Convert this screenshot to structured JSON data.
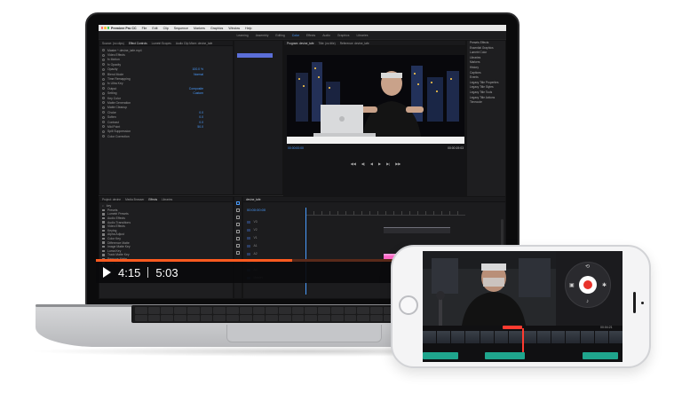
{
  "mac_menu": {
    "app": "Premiere Pro CC",
    "items": [
      "File",
      "Edit",
      "Clip",
      "Sequence",
      "Markers",
      "Graphics",
      "Window",
      "Help"
    ]
  },
  "workspaces": {
    "items": [
      "Learning",
      "Assembly",
      "Editing",
      "Color",
      "Effects",
      "Audio",
      "Graphics",
      "Libraries"
    ],
    "active_index": 3
  },
  "effect_controls": {
    "tabs": [
      "Source: (no clips)",
      "Effect Controls",
      "Lumetri Scopes",
      "Audio Clip Mixer: devine_tafe"
    ],
    "active_tab": 1,
    "rows": [
      {
        "label": "Master * devine_tafe.mp4",
        "value": ""
      },
      {
        "label": "Video Effects",
        "value": ""
      },
      {
        "label": "fx  Motion",
        "value": ""
      },
      {
        "label": "fx  Opacity",
        "value": ""
      },
      {
        "label": "Opacity",
        "value": "100.0 %"
      },
      {
        "label": "Blend Mode",
        "value": "Normal"
      },
      {
        "label": "Time Remapping",
        "value": ""
      },
      {
        "label": "fx  Ultra Key",
        "value": ""
      },
      {
        "label": "Output",
        "value": "Composite"
      },
      {
        "label": "Setting",
        "value": "Custom"
      },
      {
        "label": "Key Color",
        "value": ""
      },
      {
        "label": "Matte Generation",
        "value": ""
      },
      {
        "label": "Matte Cleanup",
        "value": ""
      },
      {
        "label": "Choke",
        "value": "0.0"
      },
      {
        "label": "Soften",
        "value": "0.0"
      },
      {
        "label": "Contrast",
        "value": "0.0"
      },
      {
        "label": "Mid Point",
        "value": "50.0"
      },
      {
        "label": "Spill Suppression",
        "value": ""
      },
      {
        "label": "Color Correction",
        "value": ""
      }
    ]
  },
  "program": {
    "tabs": [
      "Program: devine_tafe",
      "Title: (no title)",
      "Reference: devine_tafe"
    ],
    "active_tab": 0,
    "timecode": "00:00:00:00",
    "duration": "00:00:19:03",
    "transport": [
      "◀◀",
      "◀|",
      "◀",
      "▶",
      "▶|",
      "▶▶"
    ]
  },
  "effects_list": {
    "items": [
      "Presets Effects",
      "Essential Graphics",
      "Lumetri Color",
      "Libraries",
      "Markers",
      "History",
      "Captions",
      "Events",
      "Legacy Title Properties",
      "Legacy Title Styles",
      "Legacy Title Tools",
      "Legacy Title Actions",
      "Timecode"
    ]
  },
  "project": {
    "tabs": [
      "Project: devine",
      "Media Browser",
      "Effects",
      "Libraries"
    ],
    "active_tab": 2,
    "search_placeholder": "key",
    "rows": [
      "Presets",
      "Lumetri Presets",
      "Audio Effects",
      "Audio Transitions",
      "Video Effects",
      "Keying",
      "Alpha Adjust",
      "Color Key",
      "Difference Matte",
      "Image Matte Key",
      "Luma Key",
      "Track Matte Key",
      "Remove Matte",
      "Ultra Key"
    ]
  },
  "timeline": {
    "tab": "devine_tafe",
    "timecode": "00:00:00:00",
    "tracks": [
      "V3",
      "V2",
      "V1",
      "A1",
      "A2",
      "A3",
      "A4",
      "Master"
    ]
  },
  "player": {
    "current_time": "4:15",
    "total_time": "5:03",
    "progress": 0.66,
    "progress_color": "#ff5a1f"
  },
  "phone_app": {
    "timecode": "00:04:21",
    "controls": [
      "camera-switch-icon",
      "record-button",
      "mic-icon",
      "pause-icon"
    ],
    "record_color": "#e8322b",
    "audio_color": "#1fa58d"
  }
}
